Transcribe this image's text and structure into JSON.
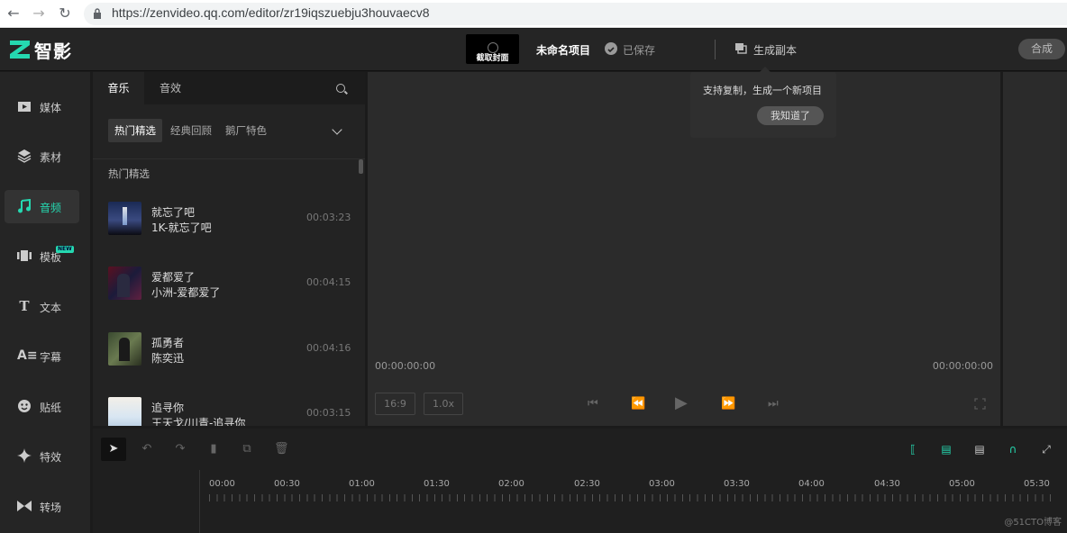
{
  "browser": {
    "url": "https://zenvideo.qq.com/editor/zr19iqszuebju3houvaecv8",
    "back_icon": "arrow-left-icon",
    "forward_icon": "arrow-right-icon",
    "reload_icon": "reload-icon"
  },
  "header": {
    "logo_text": "智影",
    "cover_label": "截取封面",
    "project_name": "未命名项目",
    "saved_label": "已保存",
    "copy_label": "生成副本",
    "export_label": "合成"
  },
  "popover": {
    "text": "支持复制，生成一个新项目",
    "button": "我知道了"
  },
  "sidenav": {
    "items": [
      {
        "label": "媒体",
        "icon": "media-icon"
      },
      {
        "label": "素材",
        "icon": "layers-icon"
      },
      {
        "label": "音频",
        "icon": "music-note-icon",
        "active": true
      },
      {
        "label": "模板",
        "icon": "template-icon",
        "badge": "NEW"
      },
      {
        "label": "文本",
        "icon": "text-icon"
      },
      {
        "label": "字幕",
        "icon": "subtitle-icon"
      },
      {
        "label": "贴纸",
        "icon": "sticker-icon"
      },
      {
        "label": "特效",
        "icon": "sparkle-icon"
      },
      {
        "label": "转场",
        "icon": "transition-icon"
      }
    ]
  },
  "music_panel": {
    "tabs": [
      "音乐",
      "音效"
    ],
    "chips": [
      "热门精选",
      "经典回顾",
      "鹅厂特色"
    ],
    "section_title": "热门精选",
    "songs": [
      {
        "title": "就忘了吧",
        "artist": "1K-就忘了吧",
        "duration": "00:03:23"
      },
      {
        "title": "爱都爱了",
        "artist": "小洲-爱都爱了",
        "duration": "00:04:15"
      },
      {
        "title": "孤勇者",
        "artist": "陈奕迅",
        "duration": "00:04:16"
      },
      {
        "title": "追寻你",
        "artist": "王天戈/川青-追寻你",
        "duration": "00:03:15"
      }
    ]
  },
  "preview": {
    "time_current": "00:00:00:00",
    "time_total": "00:00:00:00",
    "ratio": "16:9",
    "speed": "1.0x"
  },
  "timeline": {
    "ticks": [
      "00:00",
      "00:30",
      "01:00",
      "01:30",
      "02:00",
      "02:30",
      "03:00",
      "03:30",
      "04:00",
      "04:30",
      "05:00",
      "05:30"
    ]
  },
  "watermark": "@51CTO博客",
  "colors": {
    "accent": "#25d8b0",
    "background": "#1b1b1b"
  }
}
